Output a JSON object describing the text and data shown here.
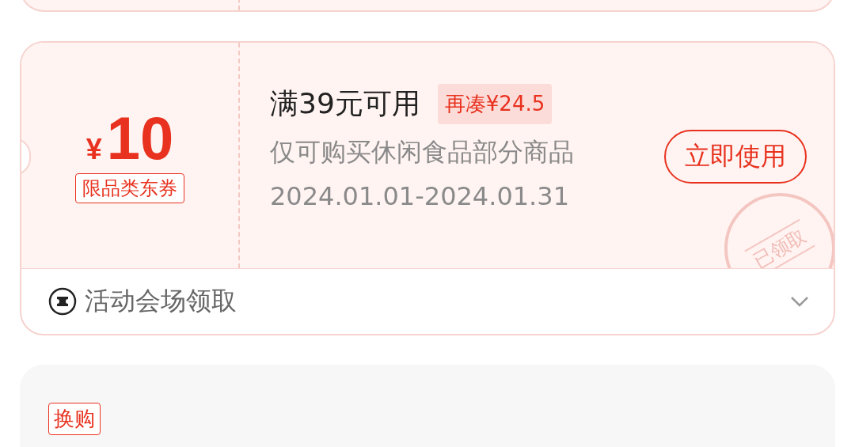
{
  "coupon": {
    "currency": "¥",
    "amount": "10",
    "scope_tag": "限品类东券",
    "condition": "满39元可用",
    "topup_tag": "再凑¥24.5",
    "description": "仅可购买休闲食品部分商品",
    "validity": "2024.01.01-2024.01.31",
    "use_button": "立即使用",
    "stamp": "已领取",
    "source": {
      "label": "活动会场领取",
      "expanded": false
    }
  },
  "next_card": {
    "tag": "换购"
  }
}
